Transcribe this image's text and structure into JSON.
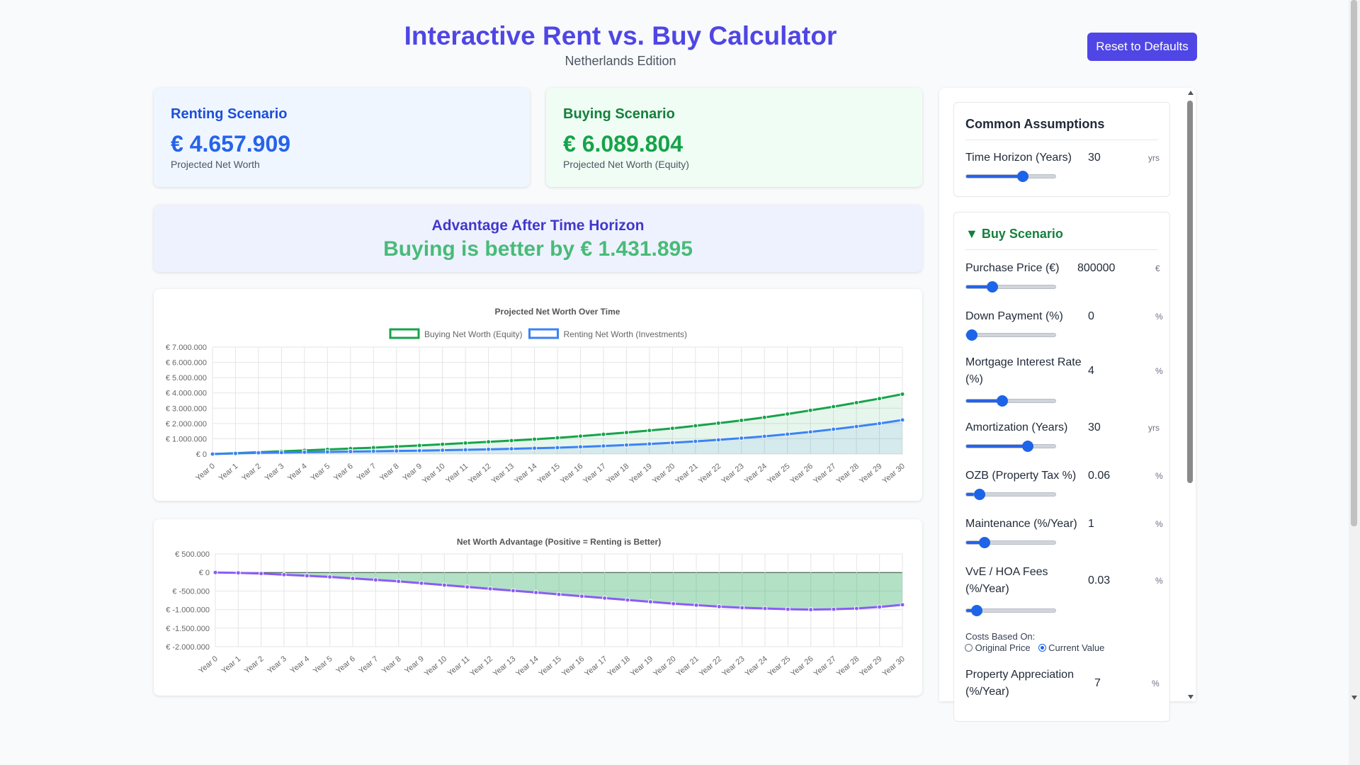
{
  "header": {
    "title": "Interactive Rent vs. Buy Calculator",
    "subtitle": "Netherlands Edition",
    "reset_label": "Reset to Defaults"
  },
  "summary": {
    "renting": {
      "title": "Renting Scenario",
      "value": "€ 4.657.909",
      "caption": "Projected Net Worth"
    },
    "buying": {
      "title": "Buying Scenario",
      "value": "€ 6.089.804",
      "caption": "Projected Net Worth (Equity)"
    }
  },
  "advantage": {
    "title": "Advantage After Time Horizon",
    "value": "Buying is better by € 1.431.895"
  },
  "colors": {
    "accent": "#4f46e5",
    "buy": "#16a34a",
    "rent": "#3b82f6",
    "advantage_line": "#8b5cf6"
  },
  "chart_data": [
    {
      "type": "line",
      "title": "Projected Net Worth Over Time",
      "x": [
        "Year 0",
        "Year 1",
        "Year 2",
        "Year 3",
        "Year 4",
        "Year 5",
        "Year 6",
        "Year 7",
        "Year 8",
        "Year 9",
        "Year 10",
        "Year 11",
        "Year 12",
        "Year 13",
        "Year 14",
        "Year 15",
        "Year 16",
        "Year 17",
        "Year 18",
        "Year 19",
        "Year 20",
        "Year 21",
        "Year 22",
        "Year 23",
        "Year 24",
        "Year 25",
        "Year 26",
        "Year 27",
        "Year 28",
        "Year 29",
        "Year 30"
      ],
      "series": [
        {
          "name": "Buying Net Worth (Equity)",
          "color": "#16a34a",
          "values": [
            0,
            60000,
            120000,
            180000,
            240000,
            300000,
            360000,
            420000,
            490000,
            560000,
            640000,
            720000,
            800000,
            880000,
            970000,
            1060000,
            1170000,
            1290000,
            1410000,
            1540000,
            1680000,
            1850000,
            2020000,
            2200000,
            2400000,
            2620000,
            2860000,
            3100000,
            3360000,
            3630000,
            3920000
          ]
        },
        {
          "name": "Renting Net Worth (Investments)",
          "color": "#3b82f6",
          "values": [
            0,
            40000,
            80000,
            100000,
            120000,
            140000,
            160000,
            180000,
            200000,
            220000,
            250000,
            280000,
            310000,
            340000,
            380000,
            420000,
            470000,
            530000,
            590000,
            660000,
            740000,
            830000,
            930000,
            1040000,
            1160000,
            1300000,
            1450000,
            1620000,
            1800000,
            2000000,
            2230000
          ]
        }
      ],
      "y_ticks": [
        "€ 7.000.000",
        "€ 6.000.000",
        "€ 5.000.000",
        "€ 4.000.000",
        "€ 3.000.000",
        "€ 2.000.000",
        "€ 1.000.000",
        "€ 0"
      ],
      "ylim": [
        0,
        7000000
      ],
      "legend": "top",
      "grid": true
    },
    {
      "type": "line",
      "title": "Net Worth Advantage (Positive = Renting is Better)",
      "x": [
        "Year 0",
        "Year 1",
        "Year 2",
        "Year 3",
        "Year 4",
        "Year 5",
        "Year 6",
        "Year 7",
        "Year 8",
        "Year 9",
        "Year 10",
        "Year 11",
        "Year 12",
        "Year 13",
        "Year 14",
        "Year 15",
        "Year 16",
        "Year 17",
        "Year 18",
        "Year 19",
        "Year 20",
        "Year 21",
        "Year 22",
        "Year 23",
        "Year 24",
        "Year 25",
        "Year 26",
        "Year 27",
        "Year 28",
        "Year 29",
        "Year 30"
      ],
      "series": [
        {
          "color": "#8b5cf6",
          "values": [
            0,
            -10000,
            -30000,
            -60000,
            -90000,
            -120000,
            -160000,
            -200000,
            -240000,
            -290000,
            -340000,
            -390000,
            -440000,
            -490000,
            -540000,
            -590000,
            -640000,
            -690000,
            -740000,
            -790000,
            -840000,
            -880000,
            -920000,
            -950000,
            -970000,
            -990000,
            -1000000,
            -990000,
            -970000,
            -930000,
            -870000
          ]
        }
      ],
      "y_ticks": [
        "€ 500.000",
        "€ 0",
        "€ -500.000",
        "€ -1.000.000",
        "€ -1.500.000",
        "€ -2.000.000"
      ],
      "ylim": [
        -2000000,
        500000
      ],
      "grid": true
    }
  ],
  "sidebar": {
    "common": {
      "title": "Common Assumptions",
      "fields": [
        {
          "label": "Time Horizon (Years)",
          "value": "30",
          "unit": "yrs",
          "level": 0.6
        }
      ]
    },
    "buy": {
      "title": "▼ Buy Scenario",
      "fields": [
        {
          "label": "Purchase Price (€)",
          "value": "800000",
          "unit": "€",
          "level": 0.24
        },
        {
          "label": "Down Payment (%)",
          "value": "0",
          "unit": "%",
          "level": 0.0
        },
        {
          "label": "Mortgage Interest Rate (%)",
          "value": "4",
          "unit": "%",
          "level": 0.36
        },
        {
          "label": "Amortization (Years)",
          "value": "30",
          "unit": "yrs",
          "level": 0.66
        },
        {
          "label": "OZB (Property Tax %)",
          "value": "0.06",
          "unit": "%",
          "level": 0.09
        },
        {
          "label": "Maintenance (%/Year)",
          "value": "1",
          "unit": "%",
          "level": 0.15
        },
        {
          "label": "VvE / HOA Fees (%/Year)",
          "value": "0.03",
          "unit": "%",
          "level": 0.06
        }
      ],
      "costs_based_on": {
        "label": "Costs Based On:",
        "options": [
          "Original Price",
          "Current Value"
        ],
        "selected": "Current Value"
      },
      "appreciation": {
        "label": "Property Appreciation (%/Year)",
        "value": "7",
        "unit": "%"
      }
    }
  }
}
